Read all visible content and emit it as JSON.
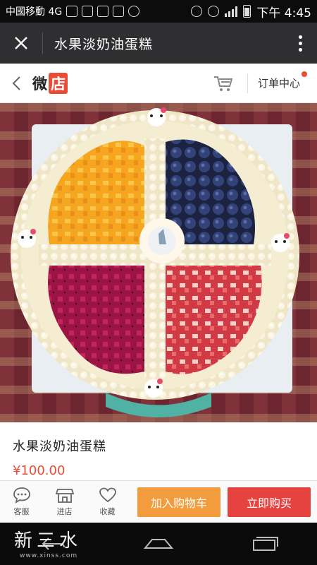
{
  "status_bar": {
    "carrier": "中國移動 4G",
    "network_label": "4G",
    "time": "下午 4:45"
  },
  "header": {
    "title": "水果淡奶油蛋糕"
  },
  "store_nav": {
    "logo_wei": "微",
    "logo_dian": "店",
    "order_center": "订单中心"
  },
  "product": {
    "title": "水果淡奶油蛋糕",
    "price": "¥100.00",
    "image_desc_colors": {
      "mango": "#f6a51e",
      "blueberry": "#2d3a66",
      "dragonfruit": "#b01a4e",
      "strawberry": "#d6404a",
      "cream": "#f3ecd6"
    }
  },
  "actions": {
    "service": "客服",
    "store": "进店",
    "favorite": "收藏",
    "add_to_cart": "加入购物车",
    "buy_now": "立即购买"
  },
  "watermark": {
    "text": "新三水",
    "url": "www.xinss.com"
  },
  "colors": {
    "header_bg": "#2f2f31",
    "accent_red": "#e94b35",
    "cart_orange": "#f39c3d",
    "buy_red": "#e64340"
  }
}
